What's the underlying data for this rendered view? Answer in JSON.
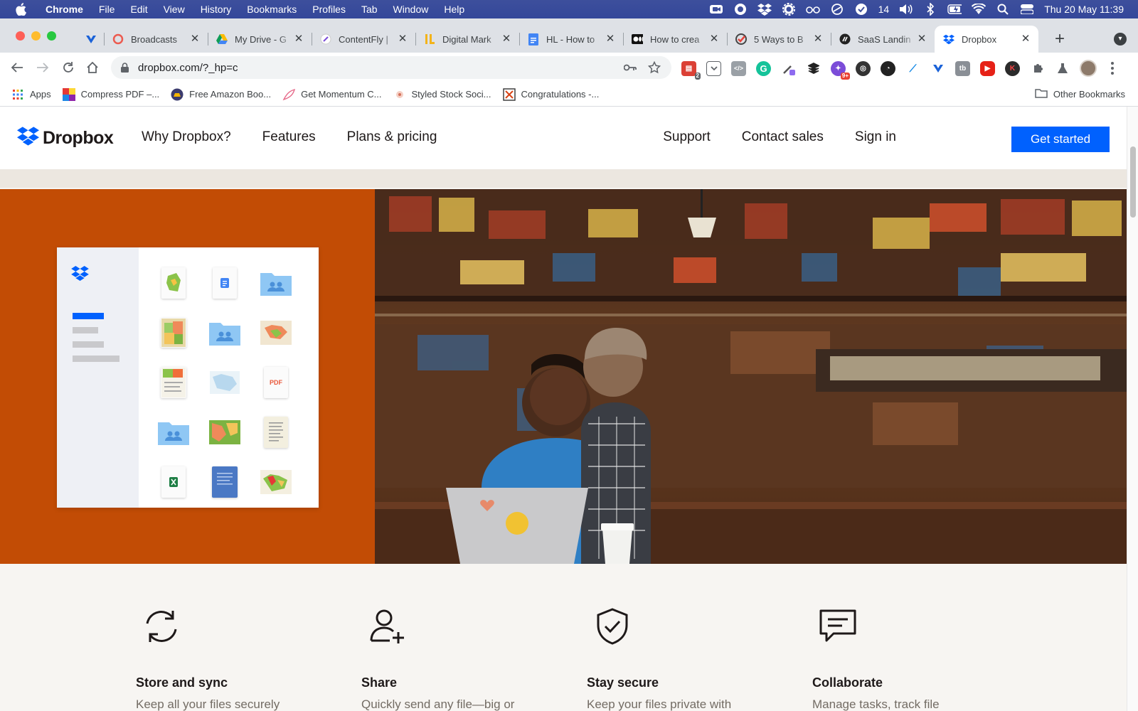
{
  "menubar": {
    "app_name": "Chrome",
    "items": [
      "File",
      "Edit",
      "View",
      "History",
      "Bookmarks",
      "Profiles",
      "Tab",
      "Window",
      "Help"
    ],
    "status_badge_count": "14",
    "datetime": "Thu 20 May  11:39"
  },
  "tabs": [
    {
      "title": "Broadcasts",
      "icon": "broadcasts-icon"
    },
    {
      "title": "My Drive - G",
      "icon": "google-drive-icon"
    },
    {
      "title": "ContentFly |",
      "icon": "contentfly-icon"
    },
    {
      "title": "Digital Mark",
      "icon": "hl-icon"
    },
    {
      "title": "HL - How to",
      "icon": "google-docs-icon"
    },
    {
      "title": "How to crea",
      "icon": "medium-icon"
    },
    {
      "title": "5 Ways to B",
      "icon": "check-icon"
    },
    {
      "title": "SaaS Landin",
      "icon": "saas-icon"
    },
    {
      "title": "Dropbox",
      "icon": "dropbox-icon",
      "active": true
    }
  ],
  "omnibox": {
    "url": "dropbox.com/?_hp=c"
  },
  "extension_badges": {
    "todoist": "2",
    "notification": "9+"
  },
  "bookmarks": {
    "apps": "Apps",
    "items": [
      "Compress PDF –...",
      "Free Amazon Boo...",
      "Get Momentum C...",
      "Styled Stock Soci...",
      "Congratulations -..."
    ],
    "other": "Other Bookmarks"
  },
  "site": {
    "brand": "Dropbox",
    "nav_left": [
      "Why Dropbox?",
      "Features",
      "Plans & pricing"
    ],
    "nav_right": [
      "Support",
      "Contact sales",
      "Sign in"
    ],
    "cta": "Get started",
    "colors": {
      "brand_blue": "#0061fe",
      "hero_orange": "#c24c05",
      "page_bg": "#f7f5f2"
    }
  },
  "mock_files": {
    "pdf_label": "PDF"
  },
  "features": [
    {
      "title": "Store and sync",
      "desc": "Keep all your files securely",
      "icon": "sync-icon"
    },
    {
      "title": "Share",
      "desc": "Quickly send any file—big or",
      "icon": "add-user-icon"
    },
    {
      "title": "Stay secure",
      "desc": "Keep your files private with",
      "icon": "shield-check-icon"
    },
    {
      "title": "Collaborate",
      "desc": "Manage tasks, track file",
      "icon": "chat-icon"
    }
  ]
}
